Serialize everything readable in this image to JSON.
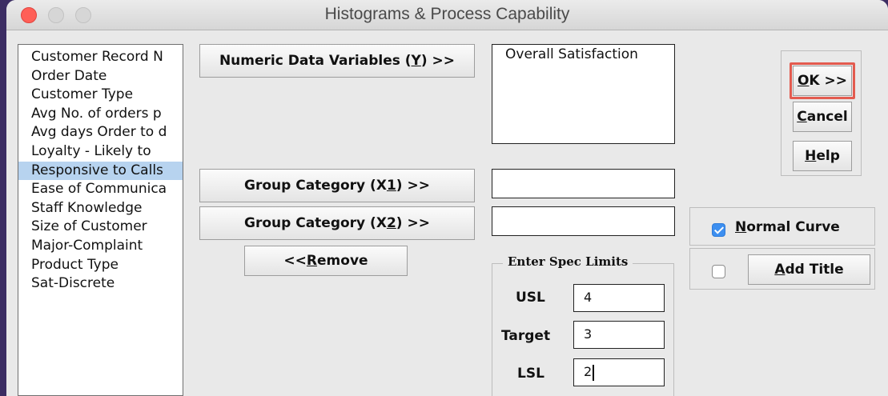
{
  "window": {
    "title": "Histograms & Process Capability"
  },
  "variables": [
    {
      "label": "Customer Record N",
      "selected": false
    },
    {
      "label": "Order Date",
      "selected": false
    },
    {
      "label": "Customer Type",
      "selected": false
    },
    {
      "label": "Avg No. of orders p",
      "selected": false
    },
    {
      "label": "Avg days Order to d",
      "selected": false
    },
    {
      "label": "Loyalty - Likely to",
      "selected": false
    },
    {
      "label": "Responsive to Calls",
      "selected": true
    },
    {
      "label": "Ease of Communica",
      "selected": false
    },
    {
      "label": "Staff Knowledge",
      "selected": false
    },
    {
      "label": "Size of Customer",
      "selected": false
    },
    {
      "label": "Major-Complaint",
      "selected": false
    },
    {
      "label": "Product Type",
      "selected": false
    },
    {
      "label": "Sat-Discrete",
      "selected": false
    }
  ],
  "numeric": {
    "button_pre": "Numeric Data Variables (",
    "button_key": "Y",
    "button_post": ") >>",
    "selected_value": "Overall Satisfaction"
  },
  "group_x1": {
    "button_pre": "Group Category (X",
    "button_key": "1",
    "button_post": ") >>",
    "value": ""
  },
  "group_x2": {
    "button_pre": "Group Category (X",
    "button_key": "2",
    "button_post": ") >>",
    "value": ""
  },
  "remove": {
    "pre": "<< ",
    "key": "R",
    "post": "emove"
  },
  "spec_limits": {
    "legend": "Enter Spec Limits",
    "usl_label": "USL",
    "usl_value": "4",
    "target_label": "Target",
    "target_value": "3",
    "lsl_label": "LSL",
    "lsl_value": "2"
  },
  "actions": {
    "ok_key": "O",
    "ok_rest": "K >>",
    "cancel_key": "C",
    "cancel_rest": "ancel",
    "help_key": "H",
    "help_rest": "elp"
  },
  "options": {
    "normal_curve": {
      "checked": true,
      "key": "N",
      "rest": "ormal Curve"
    },
    "add_title": {
      "checked": false,
      "key": "A",
      "rest": "dd Title"
    }
  },
  "colors": {
    "highlight": "#e35b4f",
    "selection": "#b7d3ef",
    "checkbox_on": "#3d8ff0"
  }
}
